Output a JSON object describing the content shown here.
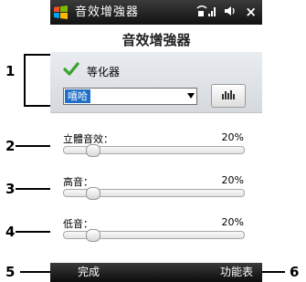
{
  "status_bar": {
    "title": "音效增強器",
    "signal_icon": "signal-icon",
    "volume_icon": "speaker-icon",
    "close_label": "×"
  },
  "header": {
    "title": "音效增強器"
  },
  "equalizer": {
    "checkbox_label": "等化器",
    "checked": true,
    "preset_value": "嘻哈"
  },
  "sliders": [
    {
      "label": "立體音效：",
      "value": "20%",
      "level": 0.2
    },
    {
      "label": "高音：",
      "value": "20%",
      "level": 0.2
    },
    {
      "label": "低音：",
      "value": "20%",
      "level": 0.2
    }
  ],
  "softkeys": {
    "left": "完成",
    "right": "功能表"
  },
  "callouts": {
    "one": "1",
    "two": "2",
    "three": "3",
    "four": "4",
    "five": "5",
    "six": "6"
  },
  "colors": {
    "selection": "#1e6fc8",
    "titlebar": "#111111",
    "check": "#3aa12a"
  }
}
